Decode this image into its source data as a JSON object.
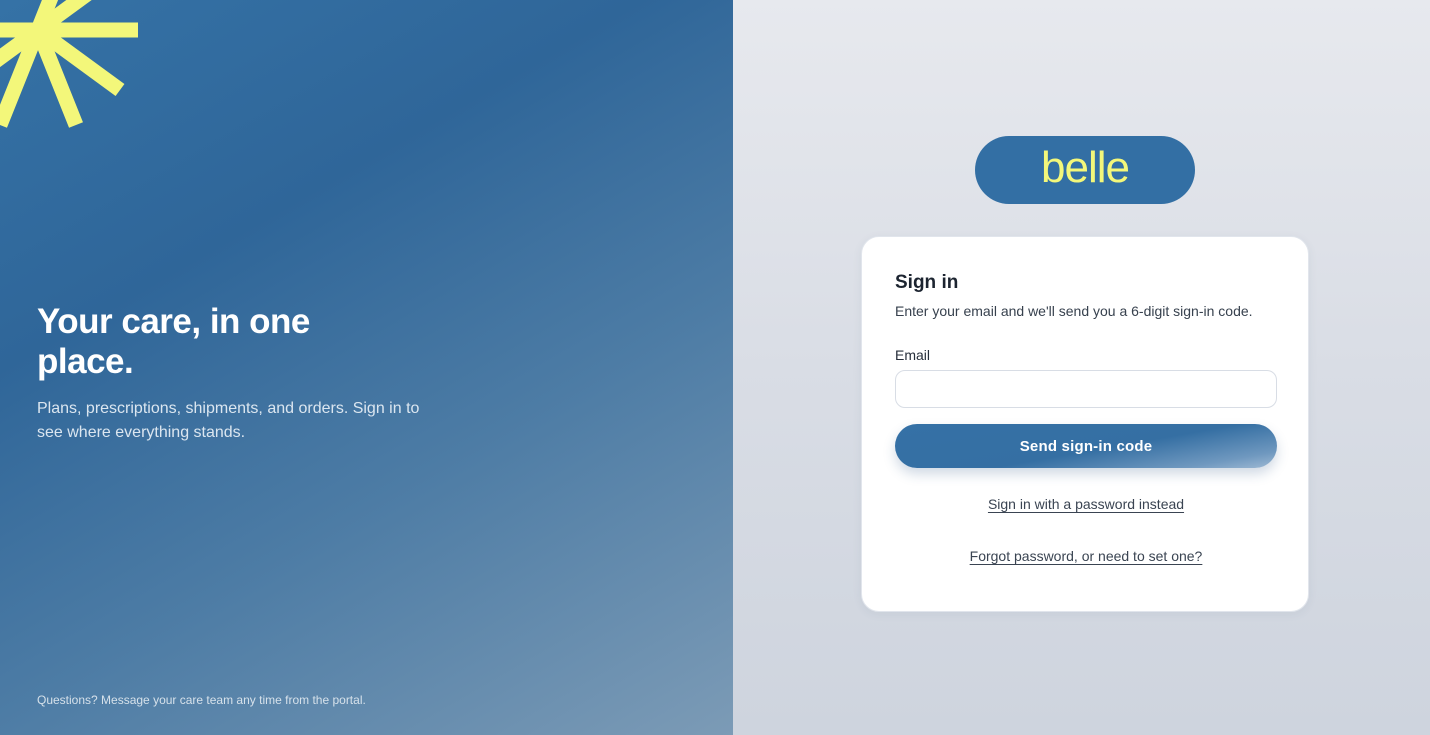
{
  "hero": {
    "title": "Your care, in one place.",
    "subtitle": "Plans, prescriptions, shipments, and orders. Sign in to see where everything stands.",
    "footnote": "Questions? Message your care team any time from the portal."
  },
  "brand": {
    "logo_text": "belle",
    "logo_color": "#f3f77a",
    "pill_color": "#336fa4",
    "accent_burst_color": "#f3f77a",
    "panel_color": "#2f6699"
  },
  "signin": {
    "title": "Sign in",
    "subtitle": "Enter your email and we'll send you a 6-digit sign-in code.",
    "email_label": "Email",
    "email_value": "",
    "email_placeholder": "",
    "send_button_label": "Send sign-in code",
    "password_link_label": "Sign in with a password instead",
    "forgot_link_label": "Forgot password, or need to set one?"
  }
}
